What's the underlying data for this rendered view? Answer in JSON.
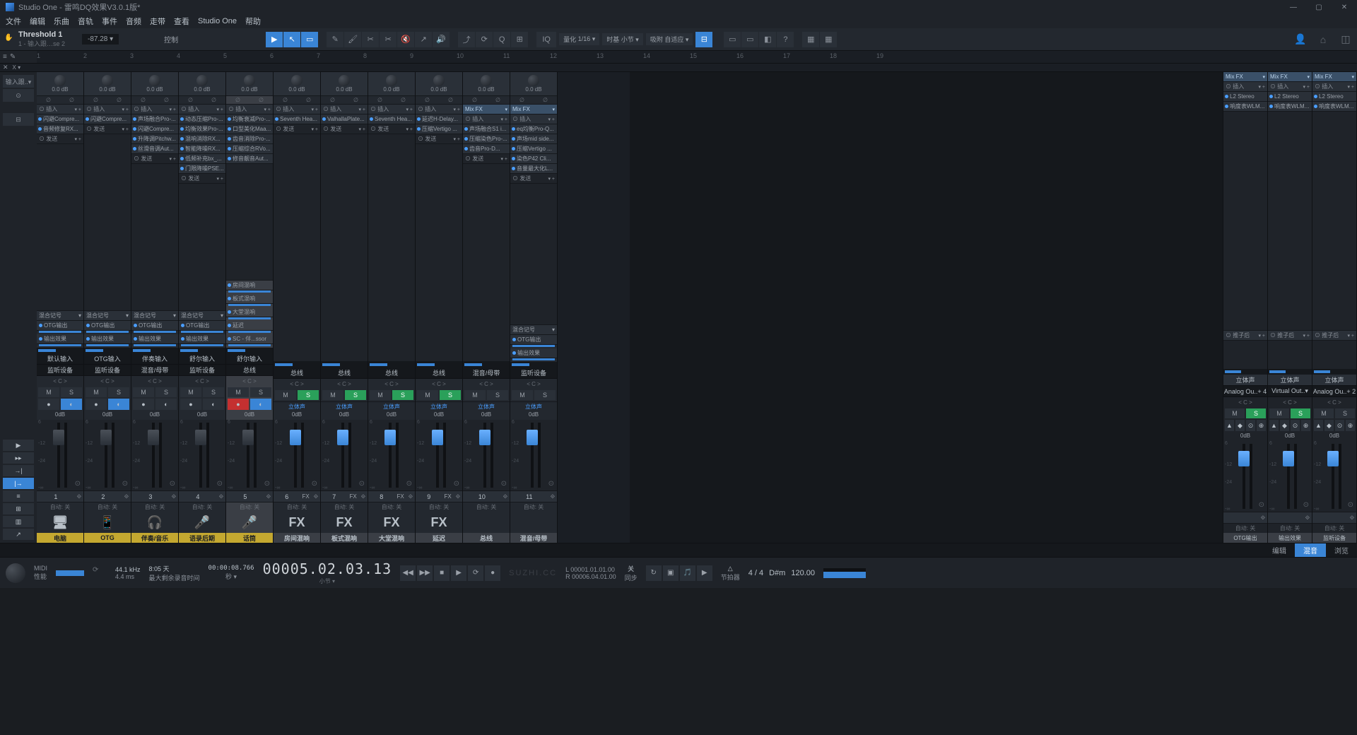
{
  "app": {
    "name": "Studio One",
    "document": "雷鸣DQ效果V3.0.1版*"
  },
  "menu": [
    "文件",
    "编辑",
    "乐曲",
    "音轨",
    "事件",
    "音频",
    "走带",
    "查看",
    "Studio One",
    "帮助"
  ],
  "inspector": {
    "title": "Threshold 1",
    "subtitle": "1 - 输入跟…se 2",
    "value": "-87.28 ▾",
    "control_label": "控制"
  },
  "toolbar": {
    "quantize_label": "量化",
    "quantize_value": "1/16 ▾",
    "timebase_label": "时基",
    "timebase_value": "小节 ▾",
    "snap_label": "吸附",
    "snap_value": "自适应 ▾"
  },
  "ruler_x": "X ▾",
  "ruler_marks": [
    "1",
    "2",
    "3",
    "4",
    "5",
    "6",
    "7",
    "8",
    "9",
    "10",
    "11",
    "12",
    "13",
    "14",
    "15",
    "16",
    "17",
    "18",
    "19"
  ],
  "left_tools": {
    "insert_label": "输入跟..▾"
  },
  "section_labels": {
    "inserts": "插入",
    "sends": "发送",
    "mixfx": "Mix FX",
    "route_mix": "混合记号",
    "otg_out": "OTG输出",
    "out_fx": "输出效果",
    "postfader": "推子后"
  },
  "channels": [
    {
      "num": "1",
      "gain": "0.0 dB",
      "inserts": [
        "闪避Compre...",
        "音频修复RX..."
      ],
      "route": "混合记号",
      "out1": "OTG输出",
      "out2": "输出效果",
      "io_top": "默认输入",
      "io_bot": "监听设备",
      "center": "< C >",
      "ms": [
        "M",
        "S"
      ],
      "rec": [
        "●",
        "◐"
      ],
      "db": "0dB",
      "automation": "自动: 关",
      "foot_label": "电脑",
      "foot_icon": "🖥",
      "foot_color": "gold"
    },
    {
      "num": "2",
      "gain": "0.0 dB",
      "inserts": [
        "闪避Compre..."
      ],
      "route": "混合记号",
      "out1": "OTG输出",
      "out2": "输出效果",
      "io_top": "OTG输入",
      "io_bot": "监听设备",
      "center": "< C >",
      "ms": [
        "M",
        "S"
      ],
      "rec": [
        "●",
        "◐"
      ],
      "db": "0dB",
      "automation": "自动: 关",
      "foot_label": "OTG",
      "foot_icon": "📱",
      "foot_color": "gold"
    },
    {
      "num": "3",
      "gain": "0.0 dB",
      "inserts": [
        "声场融合Pro-...",
        "闪避Compre...",
        "升降调Pitchw...",
        "丝滑音调Aut..."
      ],
      "route": "混合记号",
      "out1": "OTG输出",
      "out2": "输出效果",
      "io_top": "伴奏输入",
      "io_bot": "混音/母带",
      "center": "< C >",
      "ms": [
        "M",
        "S"
      ],
      "rec": [
        "●",
        "◐"
      ],
      "db": "0dB",
      "automation": "自动: 关",
      "foot_label": "伴奏/音乐",
      "foot_icon": "🎧",
      "foot_color": "gold"
    },
    {
      "num": "4",
      "gain": "0.0 dB",
      "inserts": [
        "动态压缩Pro-...",
        "均衡效果Pro-...",
        "混响消除RX...",
        "智能降噪RX...",
        "低频补充bx_...",
        "门限降噪PSE..."
      ],
      "route": "混合记号",
      "out1": "OTG输出",
      "out2": "输出效果",
      "io_top": "舒尔输入",
      "io_bot": "监听设备",
      "center": "< C >",
      "ms": [
        "M",
        "S"
      ],
      "rec": [
        "●",
        "◐"
      ],
      "db": "0dB",
      "automation": "自动: 关",
      "foot_label": "语录后期",
      "foot_icon": "🎤",
      "foot_color": "gold"
    },
    {
      "num": "5",
      "gain": "0.0 dB",
      "inserts": [
        "均衡衰减Pro-...",
        "口型美化Maa...",
        "齿音消除Pro-...",
        "压缩综合RVo...",
        "修音靓音Aut..."
      ],
      "sends": [
        "房间混响",
        "板式混响",
        "大堂混响",
        "延迟",
        "SC - 伴...ssor"
      ],
      "io_top": "舒尔输入",
      "io_bot": "总线",
      "center": "< C >",
      "ms": [
        "M",
        "S"
      ],
      "rec": [
        "●",
        "◐"
      ],
      "db": "0dB",
      "highlight": true,
      "automation": "自动: 关",
      "foot_label": "话筒",
      "foot_icon": "🎤",
      "foot_color": "gold",
      "rec_on": true
    },
    {
      "num": "6",
      "gain": "0.0 dB",
      "inserts": [
        "Seventh Hea..."
      ],
      "io_bot": "总线",
      "center": "< C >",
      "ms": [
        "M",
        "S"
      ],
      "solo_on": true,
      "stereo": "立体声",
      "db": "0dB",
      "automation": "自动: 关",
      "foot_label": "房间混响",
      "foot_icon": "FX",
      "foot_color": "gray",
      "is_fx": true
    },
    {
      "num": "7",
      "gain": "0.0 dB",
      "inserts": [
        "ValhallaPlate..."
      ],
      "io_bot": "总线",
      "center": "< C >",
      "ms": [
        "M",
        "S"
      ],
      "solo_on": true,
      "stereo": "立体声",
      "db": "0dB",
      "automation": "自动: 关",
      "foot_label": "板式混响",
      "foot_icon": "FX",
      "foot_color": "gray",
      "is_fx": true
    },
    {
      "num": "8",
      "gain": "0.0 dB",
      "inserts": [
        "Seventh Hea..."
      ],
      "io_bot": "总线",
      "center": "< C >",
      "ms": [
        "M",
        "S"
      ],
      "solo_on": true,
      "stereo": "立体声",
      "db": "0dB",
      "automation": "自动: 关",
      "foot_label": "大堂混响",
      "foot_icon": "FX",
      "foot_color": "gray",
      "is_fx": true
    },
    {
      "num": "9",
      "gain": "0.0 dB",
      "inserts": [
        "延迟H-Delay...",
        "压缩Vertigo ..."
      ],
      "io_bot": "总线",
      "center": "< C >",
      "ms": [
        "M",
        "S"
      ],
      "solo_on": true,
      "stereo": "立体声",
      "db": "0dB",
      "automation": "自动: 关",
      "foot_label": "延迟",
      "foot_icon": "FX",
      "foot_color": "gray",
      "is_fx": true
    },
    {
      "num": "10",
      "gain": "0.0 dB",
      "mixfx": true,
      "inserts": [
        "声场融合S1 i...",
        "压缩染色Pro-...",
        "齿音Pro-D..."
      ],
      "io_bot": "混音/母带",
      "center": "< C >",
      "ms": [
        "M",
        "S"
      ],
      "stereo": "立体声",
      "db": "0dB",
      "automation": "自动: 关",
      "foot_label": "总线",
      "foot_color": "gray"
    },
    {
      "num": "11",
      "gain": "0.0 dB",
      "mixfx": true,
      "inserts": [
        "eq均衡Pro-Q...",
        "声场mid side...",
        "压缩Vertigo ...",
        "染色P42 Cli...",
        "音量最大化L..."
      ],
      "route": "混合记号",
      "out1": "OTG输出",
      "out2": "输出效果",
      "io_bot": "监听设备",
      "center": "< C >",
      "ms": [
        "M",
        "S"
      ],
      "stereo": "立体声",
      "db": "0dB",
      "automation": "自动: 关",
      "foot_label": "混音/母带",
      "foot_color": "gray"
    }
  ],
  "master_channels": [
    {
      "mixfx": "Mix FX",
      "inserts": [
        "L2 Stereo",
        "响度表WLM..."
      ],
      "postfader": "推子后",
      "stereo_label": "立体声",
      "io": "Analog Ou..+ 4",
      "ms": [
        "M",
        "S"
      ],
      "solo_on": true,
      "extra": [
        "▲",
        "◆",
        "⊙",
        "⊕"
      ],
      "db": "0dB",
      "automation": "自动: 关",
      "foot": "OTG输出"
    },
    {
      "mixfx": "Mix FX",
      "inserts": [
        "L2 Stereo",
        "响度表WLM..."
      ],
      "postfader": "推子后",
      "stereo_label": "立体声",
      "io": "Virtual Out..▾",
      "ms": [
        "M",
        "S"
      ],
      "solo_on": true,
      "extra": [
        "▲",
        "◆",
        "⊙",
        "⊕"
      ],
      "db": "0dB",
      "automation": "自动: 关",
      "foot": "输出效果"
    },
    {
      "mixfx": "Mix FX",
      "inserts": [
        "L2 Stereo",
        "响度表WLM..."
      ],
      "postfader": "推子后",
      "stereo_label": "立体声",
      "io": "Analog Ou..+ 2",
      "ms": [
        "M",
        "S"
      ],
      "extra": [
        "▲",
        "◆",
        "⊙",
        "⊕"
      ],
      "db": "0dB",
      "automation": "自动: 关",
      "foot": "监听设备"
    }
  ],
  "view_tabs": {
    "edit": "编辑",
    "mix": "混音",
    "browse": "浏览"
  },
  "transport": {
    "midi": "MIDI",
    "perf": "性能",
    "sample_rate": "44.1 kHz",
    "latency": "4.4 ms",
    "rec_time_label": "8:05 天",
    "rec_time_sub": "最大剩余录音时间",
    "time1": "00:00:08.766",
    "time1_sub": "秒 ▾",
    "time_main": "00005.02.03.13",
    "time_main_sub": "小节 ▾",
    "loc_l": "L  00001.01.01.00",
    "loc_r": "R  00006.04.01.00",
    "sync": "关",
    "sync_label": "同步",
    "metro": "节拍器",
    "sig": "4 / 4",
    "key": "D#m",
    "tempo": "120.00",
    "watermark": "SUZHI.CC"
  }
}
